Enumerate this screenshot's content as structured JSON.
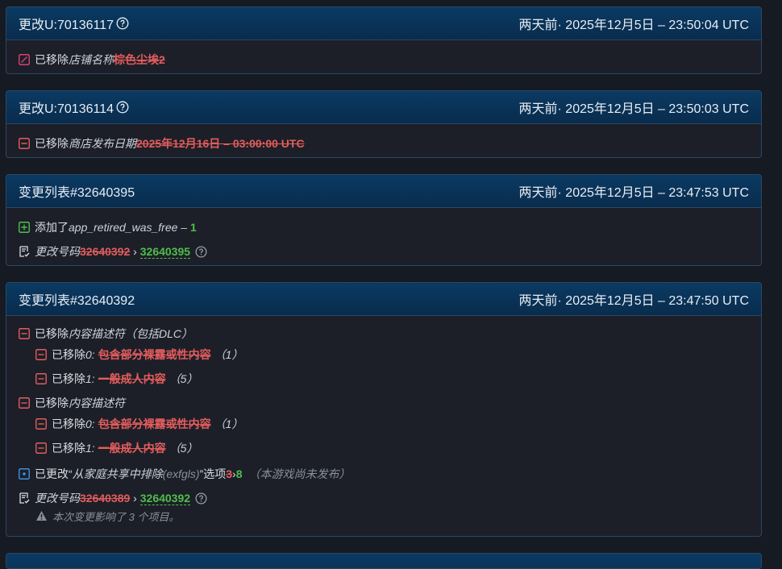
{
  "cards": [
    {
      "title": "更改U:70136117",
      "time": "两天前· 2025年12月5日 – 23:50:04 UTC",
      "rows": [
        {
          "label": "已移除",
          "field": "店铺名称 ",
          "old": "棕色尘埃2"
        }
      ]
    },
    {
      "title": "更改U:70136114",
      "time": "两天前· 2025年12月5日 – 23:50:03 UTC",
      "rows": [
        {
          "label": "已移除",
          "field": "商店发布日期 ",
          "old": "2025年12月16日 – 03:00:00 UTC"
        }
      ]
    },
    {
      "title": "变更列表#32640395",
      "time": "两天前· 2025年12月5日 – 23:47:53 UTC",
      "rows": [
        {
          "label": "添加了",
          "field": "app_retired_was_free",
          "sep": " – ",
          "new": "1"
        },
        {
          "field": "更改号码 ",
          "old": "32640392",
          "arrow": " › ",
          "new": "32640395"
        }
      ]
    },
    {
      "title": "变更列表#32640392",
      "time": "两天前· 2025年12月5日 – 23:47:50 UTC",
      "groups": [
        {
          "label": "已移除",
          "field": "内容描述符（包括DLC）",
          "items": [
            {
              "label": "已移除",
              "field": "0:",
              "old": "包含部分裸露或性内容",
              "count": "（1）"
            },
            {
              "label": "已移除",
              "field": "1:",
              "old": "一般成人内容",
              "count": "（5）"
            }
          ]
        },
        {
          "label": "已移除",
          "field": "内容描述符",
          "items": [
            {
              "label": "已移除",
              "field": "0:",
              "old": "包含部分裸露或性内容",
              "count": "（1）"
            },
            {
              "label": "已移除",
              "field": "1:",
              "old": "一般成人内容",
              "count": "（5）"
            }
          ]
        }
      ],
      "option_change": {
        "prefix": "已更改",
        "quote_open": "“",
        "name": "从家庭共享中排除",
        "key": "(exfgls)",
        "quote_close": "”",
        "suffix": "选项",
        "old": "3",
        "arrow": "›",
        "new": "8",
        "note": "（本游戏尚未发布）"
      },
      "build": {
        "field": "更改号码 ",
        "old": "32640389",
        "arrow": " › ",
        "new": "32640392"
      },
      "affect_note": "本次变更影响了 3 个项目。"
    }
  ],
  "colors": {
    "header_bg": "#0a3a63",
    "card_bg": "#1c1f28",
    "removed": "#e25c5c",
    "added": "#4fbf4a",
    "changed": "#3d8fdc"
  },
  "icons": {
    "edit": "edit-square-icon",
    "remove": "minus-square-icon",
    "add": "plus-square-icon",
    "change": "dot-square-icon",
    "build": "receipt-check-icon",
    "help": "help-circle-icon",
    "warning": "warning-icon"
  }
}
